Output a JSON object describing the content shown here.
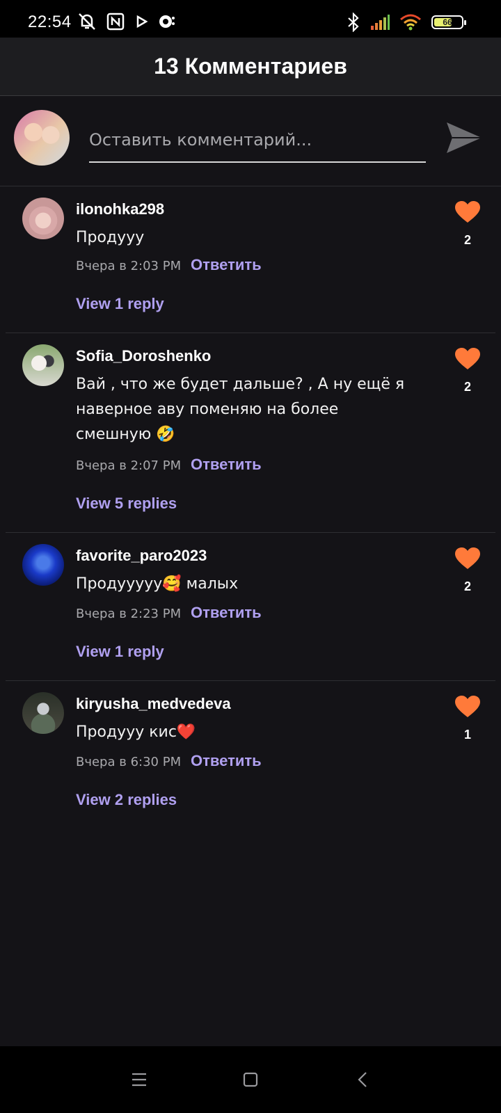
{
  "status_bar": {
    "time": "22:54",
    "icons_left": [
      "bell-off-icon",
      "nfc-icon",
      "play-icon",
      "chat-icon"
    ],
    "icons_right": [
      "bluetooth-icon",
      "signal-icon",
      "wifi-icon"
    ],
    "battery": "66"
  },
  "header": {
    "title": "13 Комментариев"
  },
  "composer": {
    "placeholder": "Оставить комментарий..."
  },
  "colors": {
    "accent": "#b0a0f0",
    "like": "#ff7a3a",
    "background": "#141317"
  },
  "comments": [
    {
      "user": "ilonohka298",
      "text": "Продууу",
      "time": "Вчера в 2:03 PM",
      "reply": "Ответить",
      "view_replies": "View 1 reply",
      "likes": "2"
    },
    {
      "user": "Sofia_Doroshenko",
      "text": "Вай , что же будет дальше? , А ну ещё я наверное аву поменяю на более смешную 🤣",
      "time": "Вчера в 2:07 PM",
      "reply": "Ответить",
      "view_replies": "View 5 replies",
      "likes": "2"
    },
    {
      "user": "favorite_paro2023",
      "text": "Продууууу🥰 малых",
      "time": "Вчера в 2:23 PM",
      "reply": "Ответить",
      "view_replies": "View 1 reply",
      "likes": "2"
    },
    {
      "user": "kiryusha_medvedeva",
      "text": "Продууу кис❤️",
      "time": "Вчера в 6:30 PM",
      "reply": "Ответить",
      "view_replies": "View 2 replies",
      "likes": "1"
    }
  ],
  "nav": [
    "menu-icon",
    "home-icon",
    "back-icon"
  ]
}
